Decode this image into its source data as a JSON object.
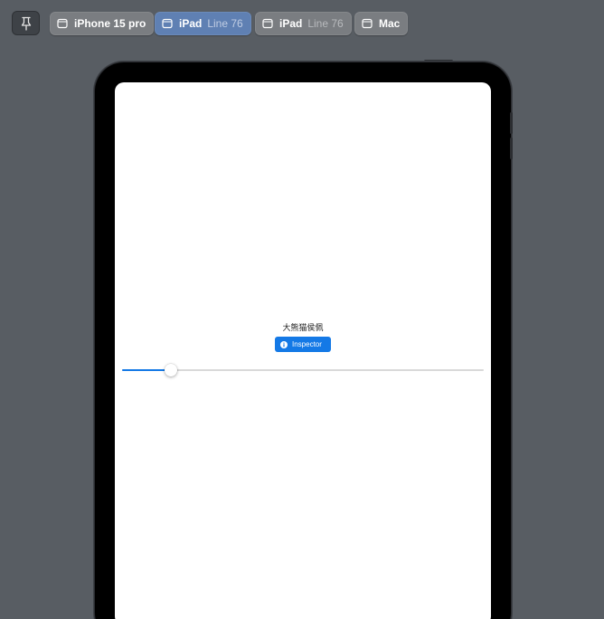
{
  "toolbar": {
    "pin": {
      "icon": "pin-icon"
    },
    "devices": [
      {
        "label": "iPhone 15 pro",
        "sub": "",
        "icon": "device-icon",
        "active": false
      },
      {
        "label": "iPad",
        "sub": "Line 76",
        "icon": "device-icon",
        "active": true
      },
      {
        "label": "iPad",
        "sub": "Line 76",
        "icon": "device-icon",
        "active": false
      },
      {
        "label": "Mac",
        "sub": "",
        "icon": "device-icon",
        "active": false
      }
    ]
  },
  "screen": {
    "title": "大熊猫侯佩",
    "inspector_button": {
      "label": "Inspector",
      "icon": "info-icon"
    },
    "slider": {
      "value": 0.123
    }
  },
  "colors": {
    "background": "#585d63",
    "chip": "#7a7d81",
    "chip_active": "#5f80b3",
    "accent": "#1479e6"
  }
}
